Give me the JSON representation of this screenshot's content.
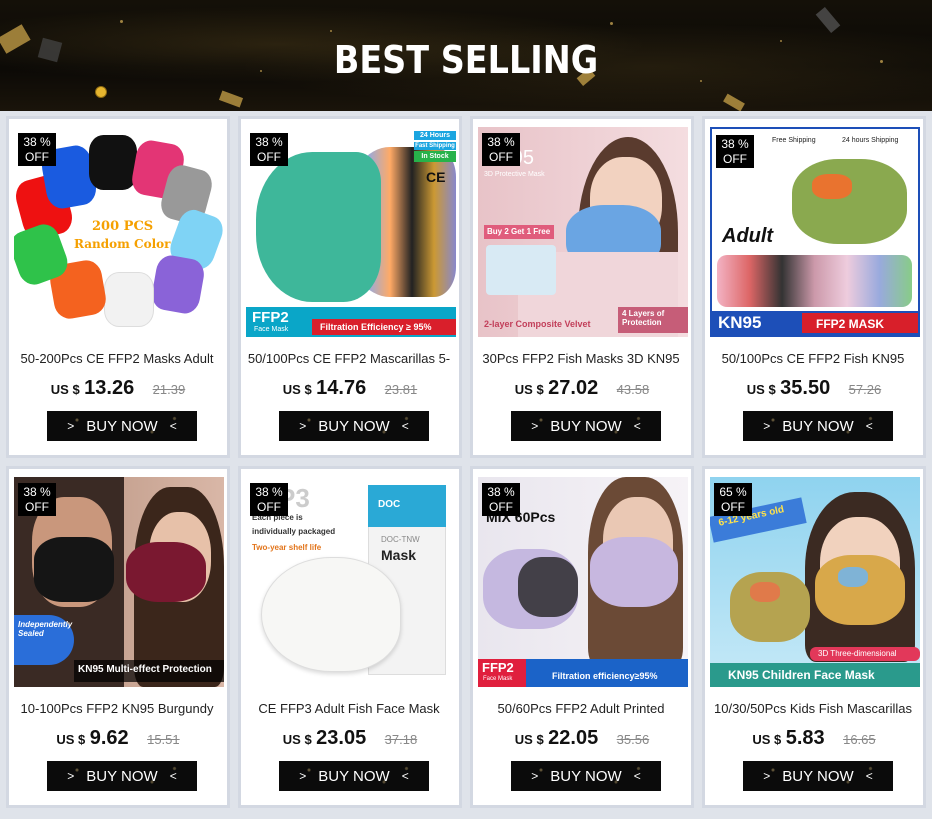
{
  "banner": {
    "title": "BEST SELLING"
  },
  "currency": "US $",
  "buy_label": "BUY NOW",
  "products": [
    {
      "discount": "38 %",
      "off": "OFF",
      "title": "50-200Pcs CE FFP2 Masks Adult",
      "price": "13.26",
      "old_price": "21.39",
      "image_text": {
        "line1": "200 PCS",
        "line2": "Random Color"
      }
    },
    {
      "discount": "38 %",
      "off": "OFF",
      "title": "50/100Pcs CE FFP2 Mascarillas 5-",
      "price": "14.76",
      "old_price": "23.81",
      "image_text": {
        "tag1": "24 Hours",
        "tag2": "Fast Shipping",
        "tag3": "In Stock",
        "ce": "CE",
        "ffp2": "FFP2",
        "sub": "Face Mask",
        "filter": "Filtration Efficiency ≥ 95%"
      }
    },
    {
      "discount": "38 %",
      "off": "OFF",
      "title": "30Pcs FFP2 Fish Masks 3D KN95",
      "price": "27.02",
      "old_price": "43.58",
      "image_text": {
        "kn95": "KN95",
        "sub": "3D Protective Mask",
        "promo": "Buy 2 Get 1 Free",
        "layers": "4 Layers of Protection",
        "bottom": "2-layer Composite Velvet"
      }
    },
    {
      "discount": "38 %",
      "off": "OFF",
      "title": "50/100Pcs CE FFP2 Fish KN95",
      "price": "35.50",
      "old_price": "57.26",
      "image_text": {
        "free": "Free Shipping",
        "hours": "24 hours Shipping",
        "adult": "Adult",
        "kn95": "KN95",
        "ffp2": "FFP2 MASK"
      }
    },
    {
      "discount": "38 %",
      "off": "OFF",
      "title": "10-100Pcs FFP2 KN95 Burgundy",
      "price": "9.62",
      "old_price": "15.51",
      "image_text": {
        "tag": "Independently Sealed",
        "bottom": "KN95 Multi-effect Protection"
      }
    },
    {
      "discount": "38 %",
      "off": "OFF",
      "title": "CE FFP3 Adult Fish Face Mask",
      "price": "23.05",
      "old_price": "37.18",
      "image_text": {
        "big": "P3",
        "line1": "Each piece is",
        "line2": "individually packaged",
        "line3": "Two-year shelf life",
        "brand": "DOC",
        "box1": "DOC-TNW",
        "box2": "Mask"
      }
    },
    {
      "discount": "38 %",
      "off": "OFF",
      "title": "50/60Pcs FFP2 Adult Printed",
      "price": "22.05",
      "old_price": "35.56",
      "image_text": {
        "mix": "MIX 60Pcs",
        "ffp2": "FFP2",
        "sub": "Face Mask",
        "filter": "Filtration efficiency≥95%"
      }
    },
    {
      "discount": "65 %",
      "off": "OFF",
      "title": "10/30/50Pcs Kids Fish Mascarillas",
      "price": "5.83",
      "old_price": "16.65",
      "image_text": {
        "ages": "6-12 years old",
        "tag": "3D Three-dimensional",
        "bottom": "KN95 Children Face Mask"
      }
    }
  ]
}
